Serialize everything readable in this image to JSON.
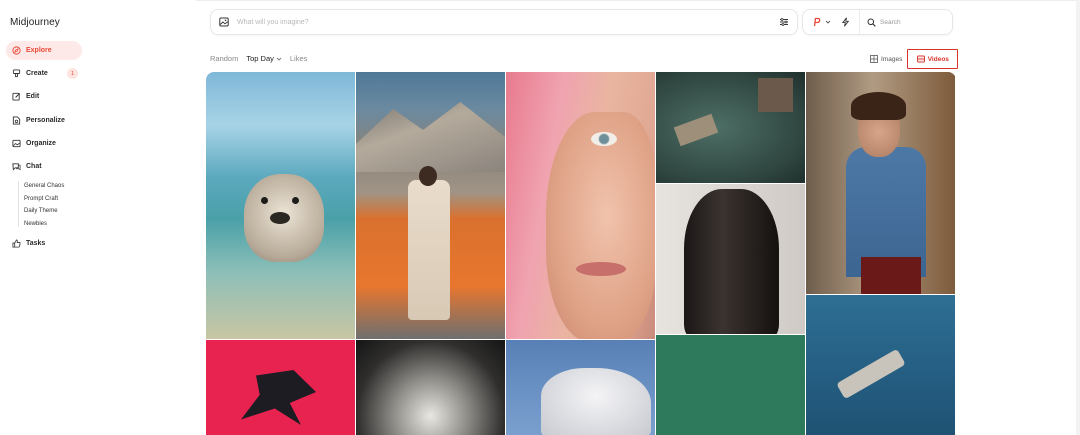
{
  "app": {
    "logo": "Midjourney"
  },
  "sidebar": {
    "items": [
      {
        "label": "Explore",
        "icon": "compass-icon",
        "active": true
      },
      {
        "label": "Create",
        "icon": "brush-icon",
        "badge": "1"
      },
      {
        "label": "Edit",
        "icon": "edit-icon"
      },
      {
        "label": "Personalize",
        "icon": "personalize-icon"
      },
      {
        "label": "Organize",
        "icon": "image-folder-icon"
      },
      {
        "label": "Chat",
        "icon": "chat-icon"
      }
    ],
    "chat_rooms": [
      "General Chaos",
      "Prompt Craft",
      "Daily Theme",
      "Newbies"
    ],
    "tasks": {
      "label": "Tasks",
      "icon": "thumbs-up-icon"
    }
  },
  "prompt": {
    "placeholder": "What will you imagine?",
    "icon": "image-icon",
    "settings_icon": "sliders-icon"
  },
  "toolbox": {
    "profile_icon": "p-icon",
    "speed_icon": "lightning-icon",
    "search_label": "Search"
  },
  "filters": {
    "random": "Random",
    "top_day": "Top Day",
    "likes": "Likes"
  },
  "media_tabs": {
    "images": "Images",
    "videos": "Videos"
  },
  "colors": {
    "accent": "#e8483a",
    "active_bg": "#fde9e7",
    "videos_border": "#d9342b"
  }
}
